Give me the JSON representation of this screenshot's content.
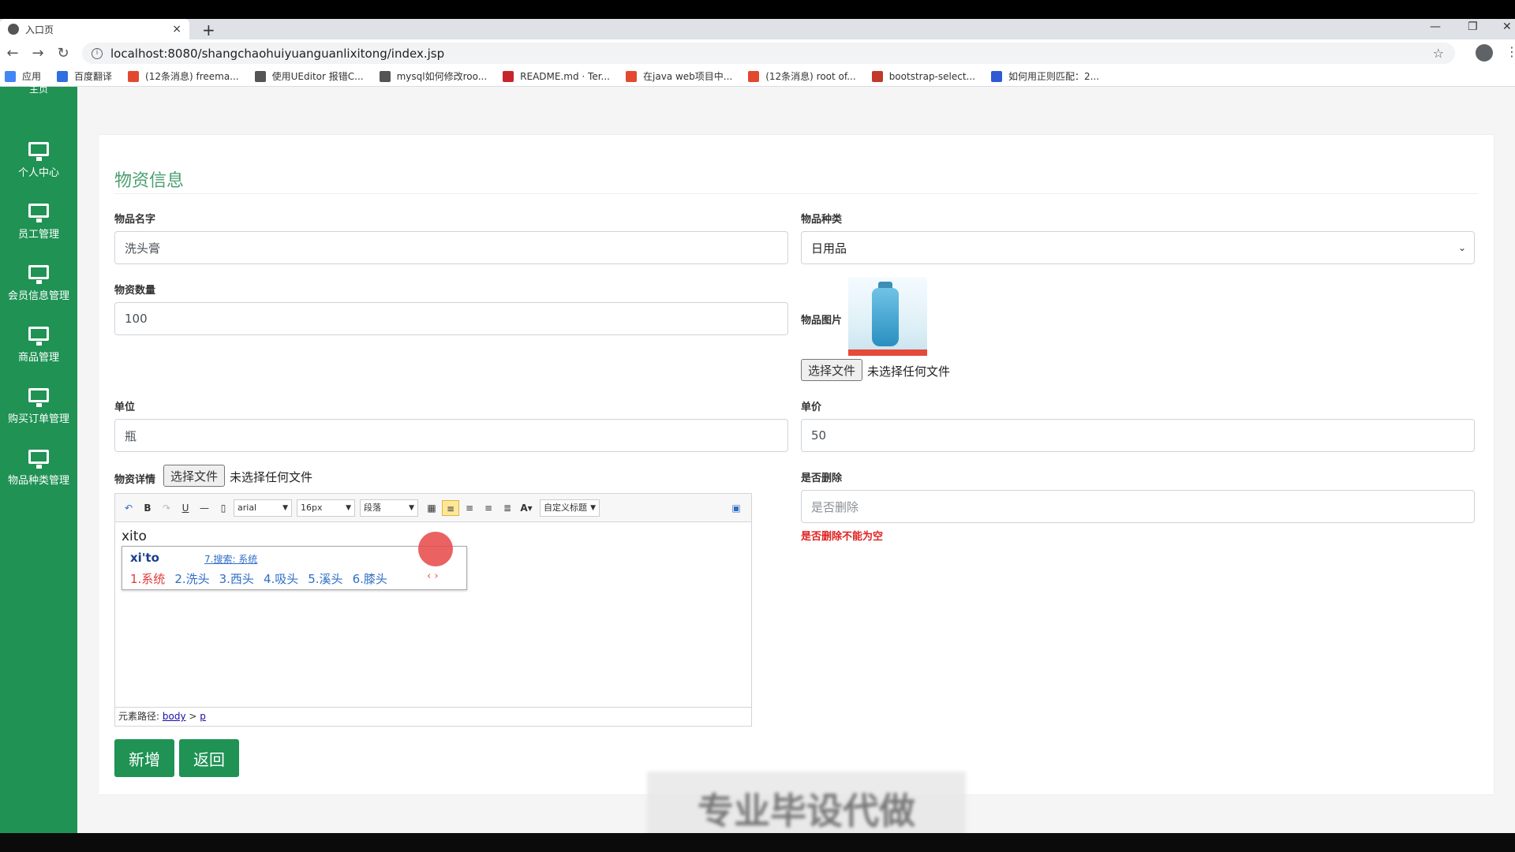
{
  "browser": {
    "tab_title": "入口页",
    "tab_close": "×",
    "new_tab": "+",
    "url": "localhost:8080/shangchaohuiyuanguanlixitong/index.jsp",
    "bookmarks": [
      {
        "label": "应用",
        "color": "#4285f4"
      },
      {
        "label": "百度翻译",
        "color": "#2f6fe0"
      },
      {
        "label": "(12条消息) freema...",
        "color": "#e2492f"
      },
      {
        "label": "使用UEditor 报错C...",
        "color": "#555555"
      },
      {
        "label": "mysql如何修改roo...",
        "color": "#555555"
      },
      {
        "label": "README.md · Ter...",
        "color": "#c7252c"
      },
      {
        "label": "在java web项目中...",
        "color": "#e2492f"
      },
      {
        "label": "(12条消息) root of...",
        "color": "#e2492f"
      },
      {
        "label": "bootstrap-select...",
        "color": "#c0392b"
      },
      {
        "label": "如何用正则匹配：2...",
        "color": "#3059d6"
      }
    ]
  },
  "sidebar": {
    "top_cut": "主页",
    "items": [
      {
        "label": "个人中心",
        "icon": "monitor-icon"
      },
      {
        "label": "员工管理",
        "icon": "monitor-icon"
      },
      {
        "label": "会员信息管理",
        "icon": "monitor-icon"
      },
      {
        "label": "商品管理",
        "icon": "monitor-icon"
      },
      {
        "label": "购买订单管理",
        "icon": "monitor-icon"
      },
      {
        "label": "物品种类管理",
        "icon": "monitor-icon"
      }
    ]
  },
  "form": {
    "title": "物资信息",
    "name_label": "物品名字",
    "name_value": "洗头膏",
    "category_label": "物品种类",
    "category_value": "日用品",
    "quantity_label": "物资数量",
    "quantity_value": "100",
    "image_label": "物品图片",
    "image_file_button": "选择文件",
    "image_file_text": "未选择任何文件",
    "unit_label": "单位",
    "unit_value": "瓶",
    "price_label": "单价",
    "price_value": "50",
    "detail_label": "物资详情",
    "detail_file_button": "选择文件",
    "detail_file_text": "未选择任何文件",
    "deleted_label": "是否删除",
    "deleted_placeholder": "是否删除",
    "deleted_error": "是否删除不能为空",
    "add_button": "新增",
    "back_button": "返回"
  },
  "editor": {
    "font_family": "arial",
    "font_size": "16px",
    "paragraph": "段落",
    "custom_title": "自定义标题",
    "content": "xito",
    "path_label": "元素路径:",
    "path_body": "body",
    "path_sep": ">",
    "path_p": "p",
    "ime": {
      "composition": "xi'to",
      "search": "7.搜索: 系统",
      "candidates": [
        "1.系统",
        "2.洗头",
        "3.西头",
        "4.吸头",
        "5.溪头",
        "6.膝头"
      ],
      "pager": "‹ ›"
    }
  },
  "watermark": "专业毕设代做",
  "colors": {
    "brand_green": "#1f9254",
    "error_red": "#e02020",
    "title_green": "#4a9f6e"
  }
}
